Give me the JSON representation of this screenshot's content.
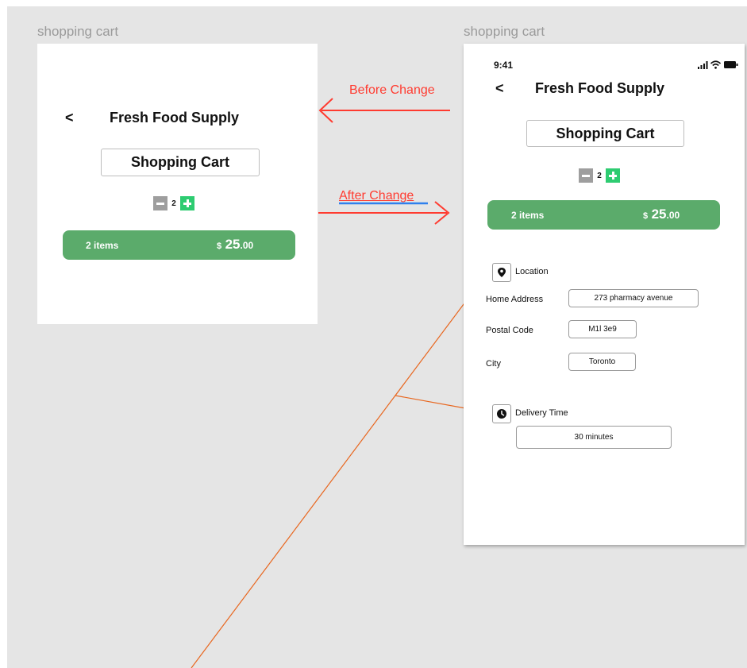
{
  "canvas_colors": {
    "background": "#e5e5e5",
    "frame": "#ffffff",
    "accent_green": "#5bab6b",
    "plus_green": "#2ecc71",
    "annotation_red": "#ff3b30",
    "connector_orange": "#e8661e"
  },
  "frames": {
    "before": {
      "label": "shopping cart",
      "back_glyph": "<",
      "title": "Fresh Food Supply",
      "cart_button": "Shopping Cart",
      "quantity": "2",
      "summary": {
        "items": "2 items",
        "currency": "$",
        "amount": "25",
        "decimals": ".00"
      }
    },
    "after": {
      "label": "shopping cart",
      "status_time": "9:41",
      "back_glyph": "<",
      "title": "Fresh Food Supply",
      "cart_button": "Shopping Cart",
      "quantity": "2",
      "summary": {
        "items": "2 items",
        "currency": "$",
        "amount": "25",
        "decimals": ".00"
      },
      "location": {
        "title": "Location",
        "icon": "location-pin-icon",
        "home_address_label": "Home Address",
        "home_address_value": "273 pharmacy avenue",
        "postal_code_label": "Postal Code",
        "postal_code_value": "M1l 3e9",
        "city_label": "City",
        "city_value": "Toronto"
      },
      "delivery": {
        "title": "Delivery Time",
        "icon": "clock-icon",
        "value": "30 minutes"
      }
    }
  },
  "annotations": {
    "before_change": "Before Change",
    "after_change": "After Change"
  }
}
